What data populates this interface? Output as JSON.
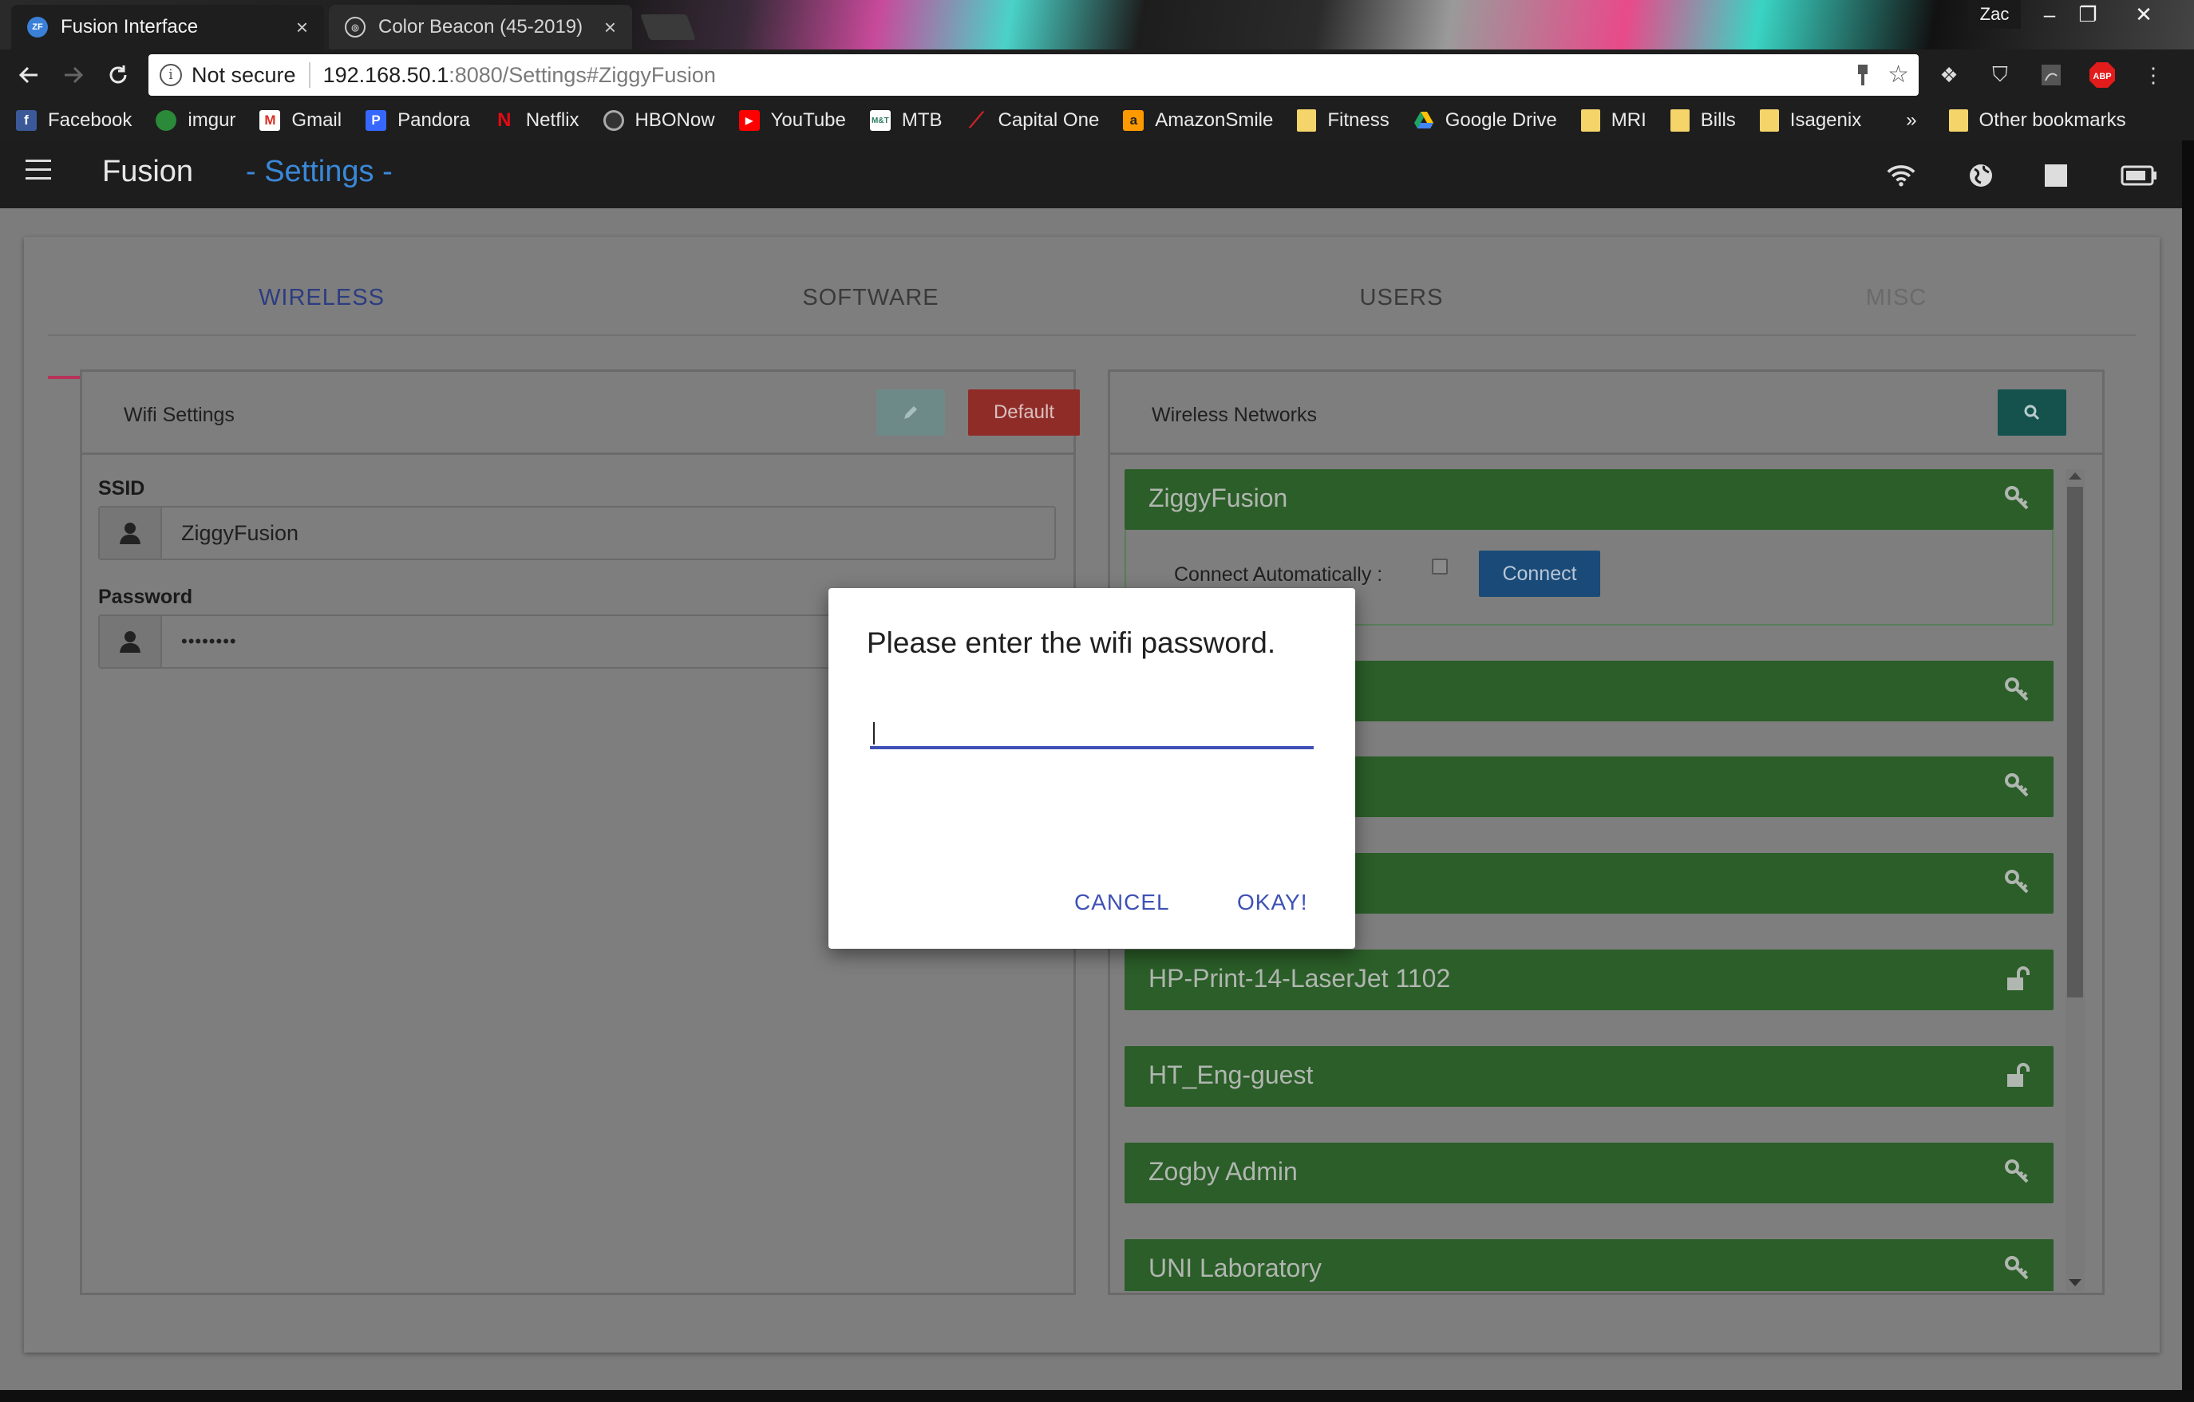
{
  "browser": {
    "tabs": [
      {
        "title": "Fusion Interface",
        "favicon": "fusion-favicon",
        "active": true
      },
      {
        "title": "Color Beacon (45-2019)",
        "favicon": "color-beacon-favicon",
        "active": false
      }
    ],
    "profile_name": "Zac",
    "security_label": "Not secure",
    "url_host": "192.168.50.1",
    "url_path": ":8080/Settings#ZiggyFusion",
    "abp_label": "ABP",
    "bookmarks": [
      {
        "label": "Facebook",
        "icon": "facebook-icon",
        "color": "#3b5998"
      },
      {
        "label": "imgur",
        "icon": "imgur-icon",
        "color": "#2a8a3a"
      },
      {
        "label": "Gmail",
        "icon": "gmail-icon",
        "color": "#d93025"
      },
      {
        "label": "Pandora",
        "icon": "pandora-icon",
        "color": "#3668ff"
      },
      {
        "label": "Netflix",
        "icon": "netflix-icon",
        "color": "#e50914"
      },
      {
        "label": "HBONow",
        "icon": "hbo-icon",
        "color": "#333333"
      },
      {
        "label": "YouTube",
        "icon": "youtube-icon",
        "color": "#ff0000"
      },
      {
        "label": "MTB",
        "icon": "mtb-icon",
        "color": "#2a7a5a"
      },
      {
        "label": "Capital One",
        "icon": "capital-one-icon",
        "color": "#cc2229"
      },
      {
        "label": "AmazonSmile",
        "icon": "amazon-icon",
        "color": "#ff9900"
      },
      {
        "label": "Fitness",
        "icon": "folder-icon",
        "color": "#f5d46a"
      },
      {
        "label": "Google Drive",
        "icon": "google-drive-icon",
        "color": "#1fa463"
      },
      {
        "label": "MRI",
        "icon": "folder-icon",
        "color": "#f5d46a"
      },
      {
        "label": "Bills",
        "icon": "folder-icon",
        "color": "#f5d46a"
      },
      {
        "label": "Isagenix",
        "icon": "folder-icon",
        "color": "#f5d46a"
      }
    ],
    "bookmarks_overflow": "»",
    "other_bookmarks": "Other bookmarks"
  },
  "app": {
    "title": "Fusion",
    "subtitle": "- Settings -",
    "tabs": [
      "WIRELESS",
      "SOFTWARE",
      "USERS",
      "MISC"
    ],
    "active_tab": "WIRELESS",
    "wifi_settings": {
      "title": "Wifi Settings",
      "default_label": "Default",
      "ssid_label": "SSID",
      "ssid_value": "ZiggyFusion",
      "password_label": "Password",
      "password_value": "••••••••"
    },
    "wireless_networks": {
      "title": "Wireless Networks",
      "connect_auto_label": "Connect Automatically :",
      "connect_label": "Connect",
      "networks": [
        {
          "name": "ZiggyFusion",
          "icon": "key-icon"
        },
        {
          "name": "",
          "icon": "key-icon"
        },
        {
          "name": "",
          "icon": "key-icon"
        },
        {
          "name": "",
          "icon": "key-icon"
        },
        {
          "name": "HP-Print-14-LaserJet 1102",
          "icon": "unlock-icon"
        },
        {
          "name": "HT_Eng-guest",
          "icon": "unlock-icon"
        },
        {
          "name": "Zogby Admin",
          "icon": "key-icon"
        },
        {
          "name": "UNI Laboratory",
          "icon": "key-icon"
        }
      ]
    }
  },
  "modal": {
    "title": "Please enter the wifi password.",
    "input_value": "",
    "cancel_label": "CANCEL",
    "okay_label": "OKAY!"
  },
  "colors": {
    "accent": "#3f51b5",
    "tab_indicator": "#e91e63",
    "network_green": "#4caf50",
    "danger": "#f44336",
    "teal": "#26a69a",
    "primary_button": "#2196f3"
  }
}
